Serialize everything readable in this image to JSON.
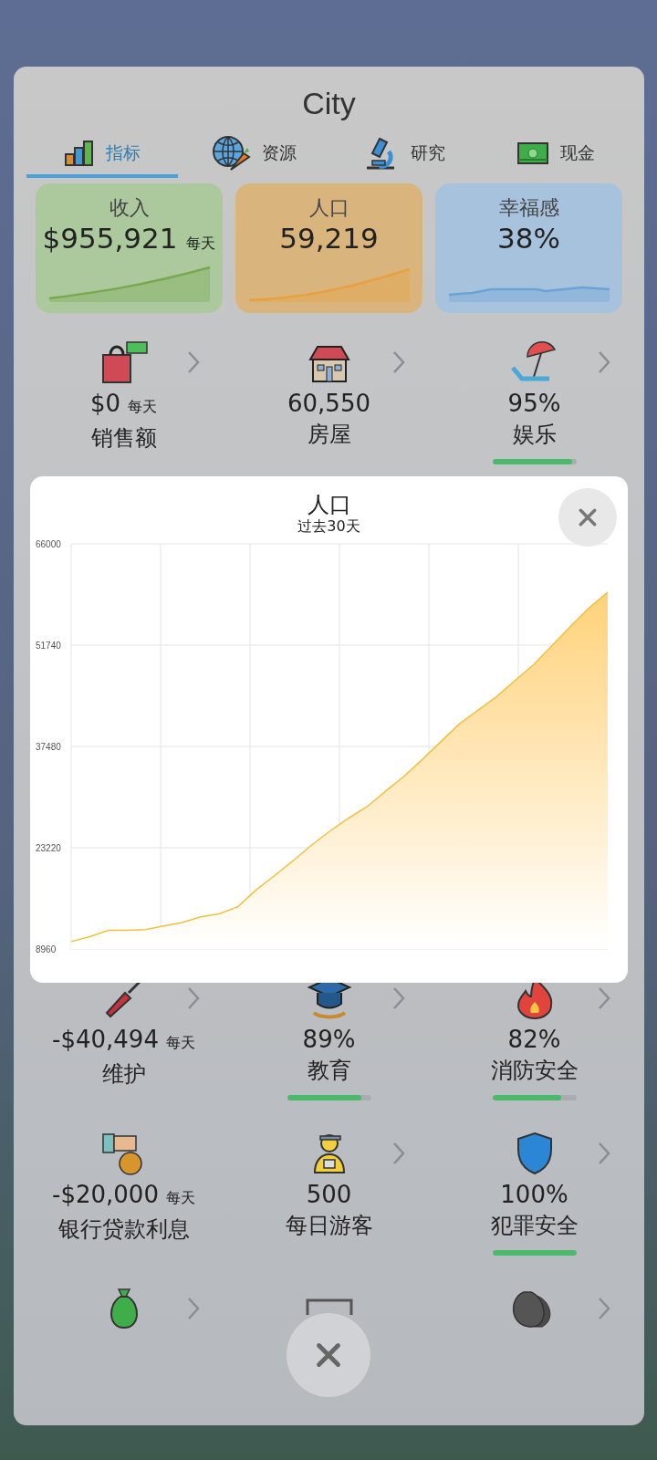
{
  "window": {
    "title": "City"
  },
  "tabs": [
    {
      "label": "指标",
      "selected": true
    },
    {
      "label": "资源",
      "selected": false
    },
    {
      "label": "研究",
      "selected": false
    },
    {
      "label": "现金",
      "selected": false
    }
  ],
  "summary_cards": [
    {
      "label": "收入",
      "value": "$955,921",
      "suffix": "每天",
      "color": "#abc99c"
    },
    {
      "label": "人口",
      "value": "59,219",
      "color": "#d9b47c"
    },
    {
      "label": "幸福感",
      "value": "38%",
      "color": "#a7c2dc"
    }
  ],
  "stat_rows": [
    [
      {
        "value": "$0",
        "suffix": "每天",
        "label": "销售额",
        "chevron": true
      },
      {
        "value": "60,550",
        "label": "房屋",
        "chevron": true
      },
      {
        "value": "95%",
        "label": "娱乐",
        "chevron": true,
        "level": 0.95
      }
    ],
    [
      {
        "value": "-$40,494",
        "suffix": "每天",
        "label": "维护",
        "chevron": true
      },
      {
        "value": "89%",
        "label": "教育",
        "chevron": true,
        "level": 0.89
      },
      {
        "value": "82%",
        "label": "消防安全",
        "chevron": true,
        "level": 0.82
      }
    ],
    [
      {
        "value": "-$20,000",
        "suffix": "每天",
        "label": "银行贷款利息",
        "chevron": false
      },
      {
        "value": "500",
        "label": "每日游客",
        "chevron": true
      },
      {
        "value": "100%",
        "label": "犯罪安全",
        "chevron": true,
        "level": 1
      }
    ],
    [
      {
        "chevron": true
      },
      {
        "chevron": false
      },
      {
        "chevron": true
      }
    ]
  ],
  "chart_popup": {
    "title": "人口",
    "subtitle": "过去30天",
    "chart_data": {
      "type": "area",
      "grid": true,
      "ylim": [
        8960,
        66000
      ],
      "yticks": [
        8960,
        23220,
        37480,
        51740,
        66000
      ],
      "series": [
        {
          "color": "#f0c040",
          "values": [
            10000,
            10700,
            11600,
            11600,
            11700,
            12200,
            12700,
            13500,
            13900,
            14900,
            17300,
            19300,
            21400,
            23600,
            25600,
            27400,
            29000,
            31200,
            33300,
            35700,
            38200,
            40700,
            42600,
            44500,
            46800,
            49000,
            51700,
            54400,
            57000,
            59200
          ]
        }
      ]
    }
  }
}
